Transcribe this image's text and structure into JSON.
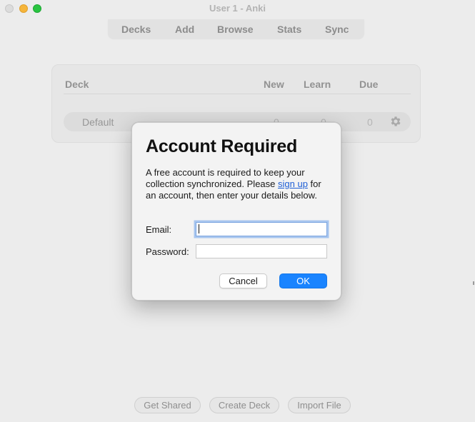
{
  "window": {
    "title": "User 1 - Anki"
  },
  "nav": {
    "items": [
      "Decks",
      "Add",
      "Browse",
      "Stats",
      "Sync"
    ]
  },
  "deck_table": {
    "headers": {
      "deck": "Deck",
      "new": "New",
      "learn": "Learn",
      "due": "Due"
    },
    "rows": [
      {
        "name": "Default",
        "new": "0",
        "learn": "0",
        "due": "0",
        "options_icon": "gear-icon"
      }
    ]
  },
  "bottom_bar": {
    "get_shared": "Get Shared",
    "create_deck": "Create Deck",
    "import_file": "Import File"
  },
  "dialog": {
    "title": "Account Required",
    "text_before_link": "A free account is required to keep your collection synchronized. Please ",
    "link_text": "sign up",
    "text_after_link": " for an account, then enter your details below.",
    "email_label": "Email:",
    "email_value": "",
    "password_label": "Password:",
    "password_value": "",
    "cancel_label": "Cancel",
    "ok_label": "OK"
  },
  "colors": {
    "accent": "#1a84ff",
    "link": "#1f5fd6",
    "focus_ring": "#a8c6ef",
    "traffic_close": "#dcdcdc",
    "traffic_minimize": "#f6b53a",
    "traffic_maximize": "#29c441"
  }
}
